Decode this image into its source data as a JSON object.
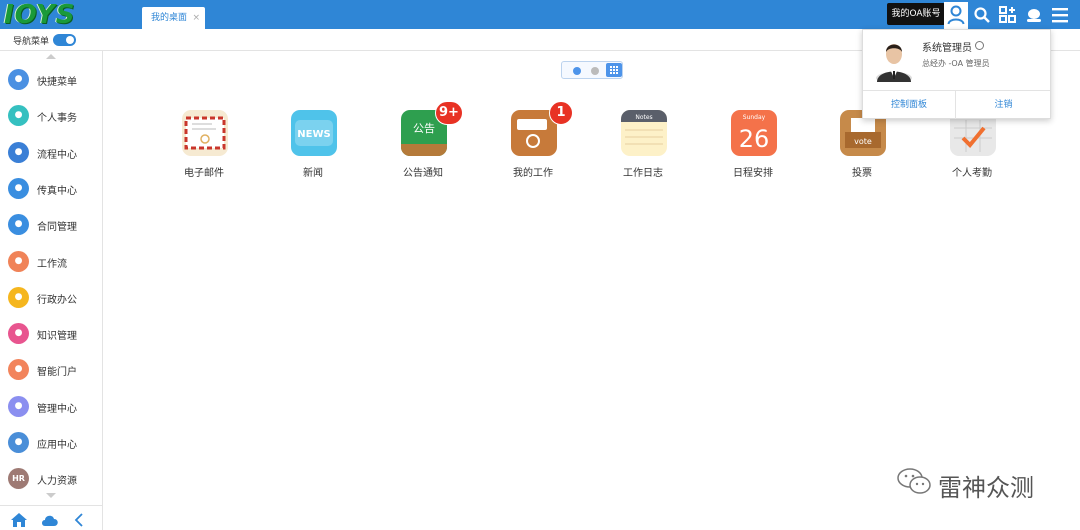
{
  "header": {
    "logo_text": "IOYS",
    "tab_label": "我的桌面",
    "tab_close": "×",
    "tooltip": "我的OA账号",
    "icons": [
      "user-icon",
      "search-icon",
      "apps-icon",
      "skin-icon",
      "menu-icon"
    ]
  },
  "subbar": {
    "nav_menu_label": "导航菜单",
    "nav_toggle_on": true
  },
  "sidebar": {
    "items": [
      {
        "label": "快捷菜单",
        "color": "#4a90e2",
        "icon": "share-icon"
      },
      {
        "label": "个人事务",
        "color": "#35c0c0",
        "icon": "person-icon"
      },
      {
        "label": "流程中心",
        "color": "#3a7fd6",
        "icon": "flow-icon"
      },
      {
        "label": "传真中心",
        "color": "#3a8ee0",
        "icon": "fax-icon"
      },
      {
        "label": "合同管理",
        "color": "#3a8ee0",
        "icon": "contract-icon"
      },
      {
        "label": "工作流",
        "color": "#f08358",
        "icon": "workflow-icon"
      },
      {
        "label": "行政办公",
        "color": "#f5b61e",
        "icon": "admin-icon"
      },
      {
        "label": "知识管理",
        "color": "#e8558f",
        "icon": "book-icon"
      },
      {
        "label": "智能门户",
        "color": "#f2845c",
        "icon": "portal-icon"
      },
      {
        "label": "管理中心",
        "color": "#8b8ff0",
        "icon": "manage-icon"
      },
      {
        "label": "应用中心",
        "color": "#4a8ed8",
        "icon": "apps-center-icon"
      },
      {
        "label": "人力资源",
        "color": "#9e7a74",
        "icon": "hr-icon"
      }
    ],
    "hr_glyph": "HR"
  },
  "desktop": {
    "apps": [
      {
        "label": "电子邮件",
        "icon": "mail-icon",
        "badge": ""
      },
      {
        "label": "新闻",
        "icon": "news-icon",
        "badge": "",
        "icon_text": "NEWS"
      },
      {
        "label": "公告通知",
        "icon": "notice-icon",
        "badge": "9+",
        "icon_text": "公告"
      },
      {
        "label": "我的工作",
        "icon": "work-icon",
        "badge": "1"
      },
      {
        "label": "工作日志",
        "icon": "notes-icon",
        "badge": "",
        "icon_text": "Notes"
      },
      {
        "label": "日程安排",
        "icon": "calendar-icon",
        "badge": "",
        "icon_text": "Sunday",
        "icon_num": "26"
      },
      {
        "label": "投票",
        "icon": "vote-icon",
        "badge": "",
        "icon_text": "vote"
      },
      {
        "label": "个人考勤",
        "icon": "attendance-icon",
        "badge": ""
      }
    ],
    "page_dots": 2,
    "active_page": 1
  },
  "popup": {
    "user_name": "系统管理员",
    "role": "总经办 -OA 管理员",
    "btn_control": "控制面板",
    "btn_logout": "注销"
  },
  "watermark": {
    "text": "雷神众测"
  },
  "colors": {
    "accent": "#2f86d6",
    "badge": "#e83224"
  }
}
